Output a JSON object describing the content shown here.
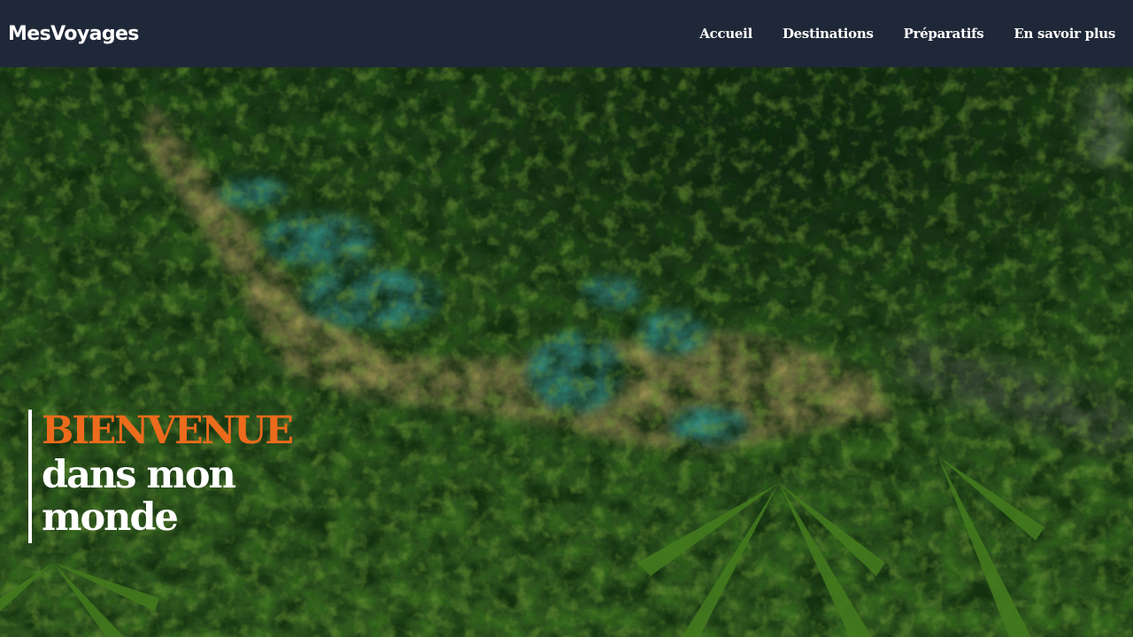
{
  "brand": {
    "name": "MesVoyages"
  },
  "nav": {
    "items": [
      {
        "label": "Accueil"
      },
      {
        "label": "Destinations"
      },
      {
        "label": "Préparatifs"
      },
      {
        "label": "En savoir plus"
      }
    ]
  },
  "hero": {
    "line1": "BIENVENUE",
    "line2": "dans mon monde",
    "accent_color": "#ec6b1c",
    "header_color": "#1f2838"
  }
}
